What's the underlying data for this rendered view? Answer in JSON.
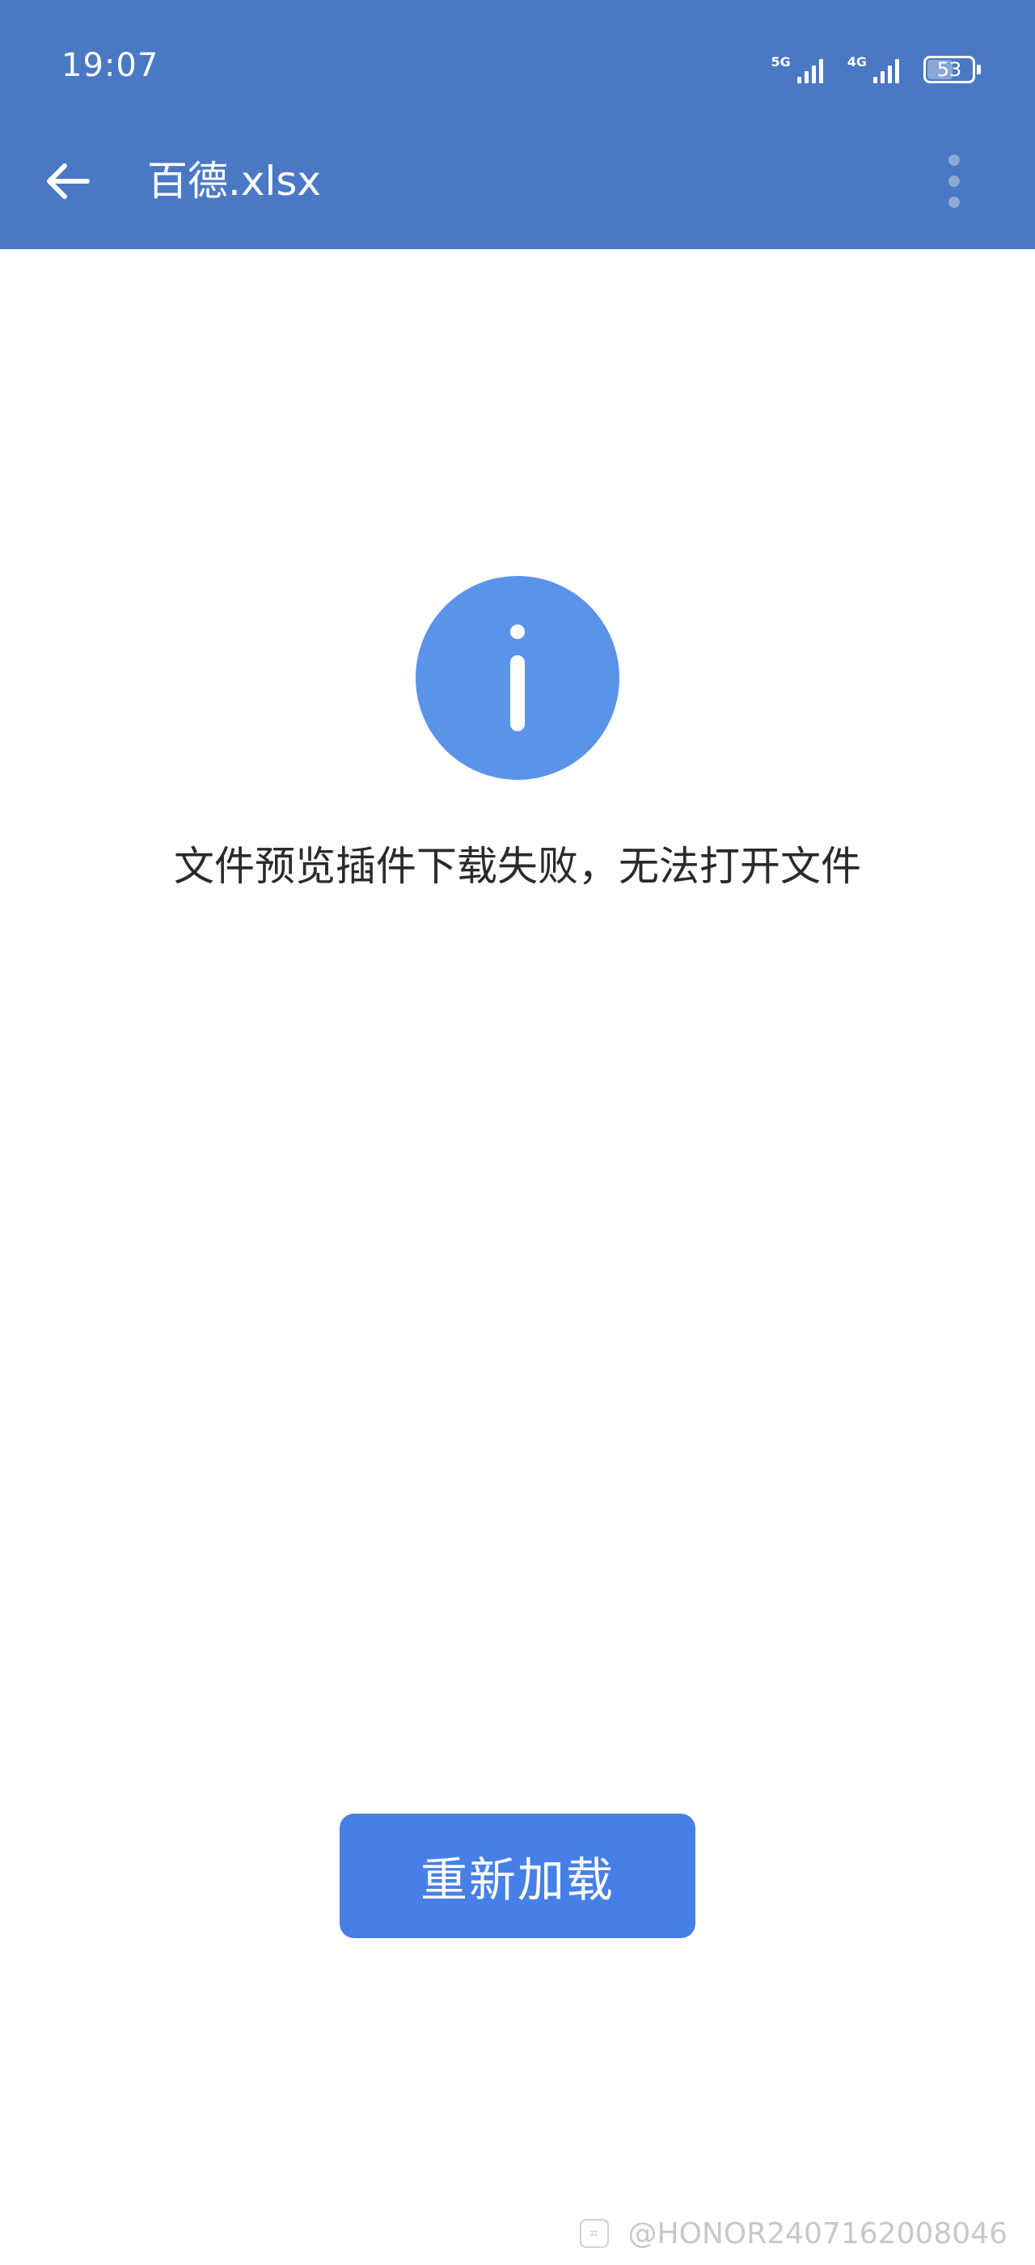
{
  "status_bar": {
    "time": "19:07",
    "network_1": "5G",
    "network_2": "4G",
    "battery_level": "53"
  },
  "toolbar": {
    "title": "百德.xlsx",
    "back_icon": "arrow-left-icon",
    "menu_icon": "more-vertical-icon"
  },
  "content": {
    "status_icon": "info-icon",
    "message": "文件预览插件下载失败，无法打开文件",
    "reload_label": "重新加载"
  },
  "watermark": {
    "text": "@HONOR2407162008046"
  },
  "colors": {
    "header": "#4a78c4",
    "icon_circle": "#5b93e9",
    "button": "#4680e6"
  }
}
